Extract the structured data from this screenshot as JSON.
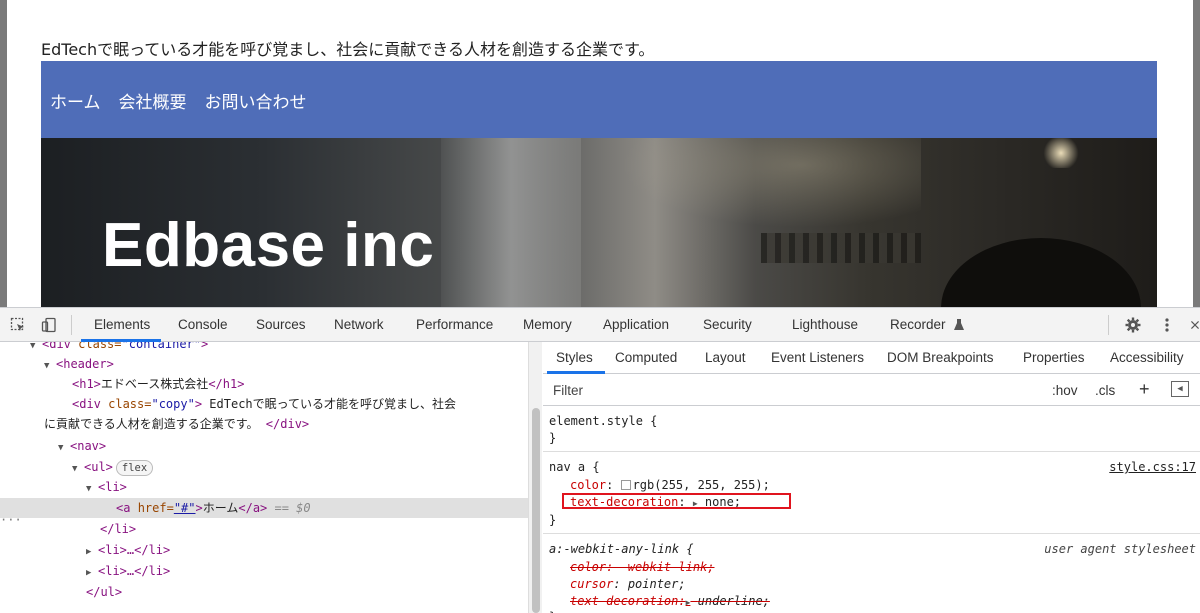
{
  "page": {
    "copy_text": "EdTechで眠っている才能を呼び覚まし、社会に貢献できる人材を創造する企業です。",
    "nav_items": [
      "ホーム",
      "会社概要",
      "お問い合わせ"
    ],
    "hero_title": "Edbase inc"
  },
  "devtools": {
    "tabs": [
      "Elements",
      "Console",
      "Sources",
      "Network",
      "Performance",
      "Memory",
      "Application",
      "Security",
      "Lighthouse",
      "Recorder"
    ],
    "active_tab": "Elements",
    "dom": {
      "line0": "div",
      "line0_class": "\"container\"",
      "header": "header",
      "h1_open": "<h1>",
      "h1_text": "エドベース株式会社",
      "h1_close": "</h1>",
      "copy_open": "<div ",
      "copy_attr": "class=",
      "copy_val": "\"copy\"",
      "copy_text_1": " EdTechで眠っている才能を呼び覚まし、社会",
      "copy_text_2": "に貢献できる人材を創造する企業です。 ",
      "copy_close": "</div>",
      "nav": "<nav>",
      "ul": "<ul>",
      "flex_badge": "flex",
      "li": "<li>",
      "a_open": "<a ",
      "a_attr": "href=",
      "a_val": "\"#\"",
      "a_text": "ホーム",
      "a_close": "</a>",
      "a_eq": " == $0",
      "li_close": "</li>",
      "li_collapsed_1": "<li>…</li>",
      "li_collapsed_2": "<li>…</li>",
      "ul_close": "</ul>",
      "ellipsis": "···"
    },
    "styles": {
      "tabs": [
        "Styles",
        "Computed",
        "Layout",
        "Event Listeners",
        "DOM Breakpoints",
        "Properties",
        "Accessibility"
      ],
      "filter_placeholder": "Filter",
      "hov": ":hov",
      "cls": ".cls",
      "plus": "+",
      "element_style_selector": "element.style {",
      "close_brace": "}",
      "rule1_selector": "nav a {",
      "rule1_source": "style.css:17",
      "rule1_color_prop": "color",
      "rule1_color_val": "rgb(255, 255, 255);",
      "rule1_td_prop": "text-decoration",
      "rule1_td_val": "none;",
      "rule2_selector": "a:-webkit-any-link {",
      "rule2_source": "user agent stylesheet",
      "rule2_color": "color: -webkit-link;",
      "rule2_cursor_prop": "cursor",
      "rule2_cursor_val": "pointer;",
      "rule2_td_prop": "text-decoration:",
      "rule2_td_val": "underline;"
    }
  },
  "colors": {
    "nav_bg": "#4f6db8",
    "accent": "#1a73e8",
    "highlight": "#e0141e"
  }
}
